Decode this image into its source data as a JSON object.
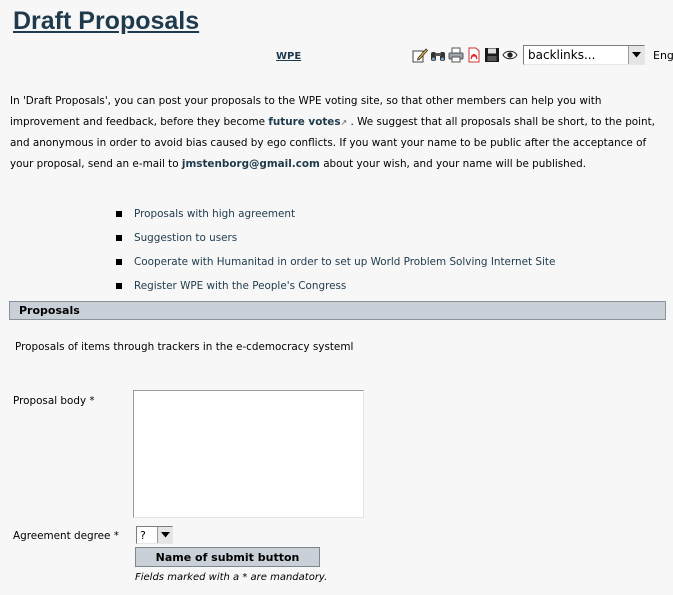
{
  "page": {
    "title": "Draft Proposals",
    "wpe_link": "WPE"
  },
  "toolbar": {
    "icons": [
      "edit-icon",
      "binoculars-icon",
      "print-icon",
      "pdf-icon",
      "save-icon",
      "watch-icon"
    ],
    "backlinks_value": "backlinks...",
    "language": "English"
  },
  "intro": {
    "p1": "In 'Draft Proposals', you can post your proposals to the WPE voting site, so that other members can help you with improvement and feedback, before they become ",
    "future_votes_link": "future votes",
    "ext_icon": "↗",
    "p2": " . We suggest that all proposals shall be short, to the point, and anonymous in order to avoid bias caused by ego conflicts. If you want your name to be public after the acceptance of your proposal, send an e-mail to ",
    "email_link": "jmstenborg@gmail.com",
    "p3": " about your wish, and your name will be published."
  },
  "links": [
    {
      "label": "Proposals with high agreement"
    },
    {
      "label": "Suggestion to users"
    },
    {
      "label": "Cooperate with Humanitad in order to set up World Problem Solving Internet Site"
    },
    {
      "label": "Register WPE with the People's Congress"
    }
  ],
  "section": {
    "header": "Proposals",
    "subtitle": "Proposals of items through trackers in the e-cdemocracy systeml"
  },
  "form": {
    "body_label": "Proposal body *",
    "body_value": "",
    "agreement_label": "Agreement degree *",
    "agreement_value": "?",
    "submit_label": "Name of submit button",
    "mandatory_note": "Fields marked with a * are mandatory."
  }
}
